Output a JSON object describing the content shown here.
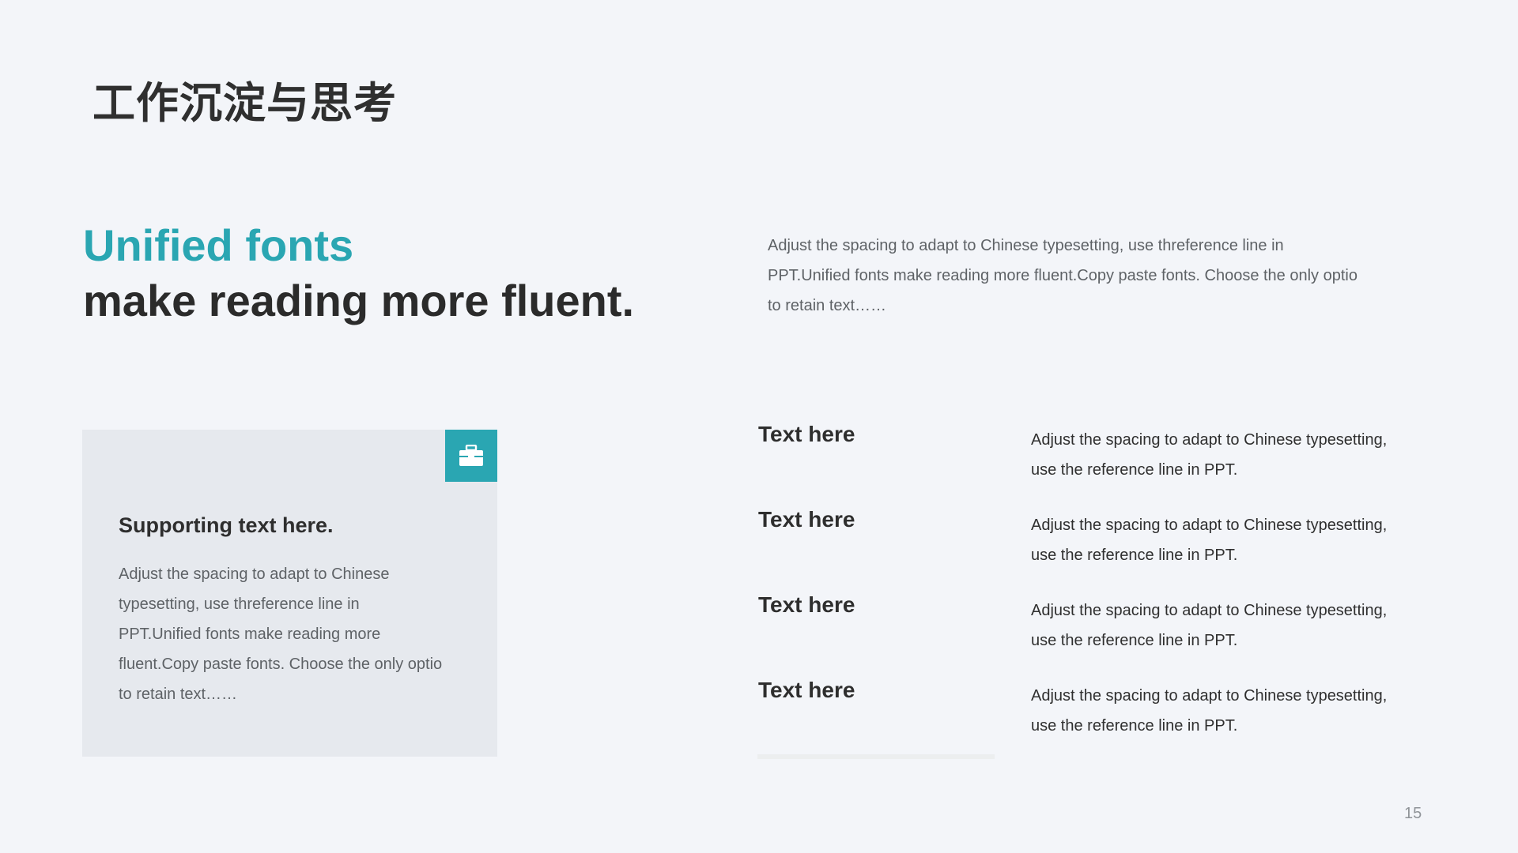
{
  "page": {
    "title": "工作沉淀与思考",
    "number": "15"
  },
  "headline": {
    "accent": "Unified fonts",
    "main": "make reading more fluent."
  },
  "intro": {
    "text": "Adjust the spacing to adapt to Chinese typesetting, use threference line in PPT.Unified fonts make reading more fluent.Copy paste fonts. Choose the only optio to retain text……"
  },
  "card": {
    "icon": "toolbox-icon",
    "heading": "Supporting text here.",
    "body": "Adjust the spacing to adapt to Chinese typesetting, use threference line in PPT.Unified fonts make reading more fluent.Copy paste fonts. Choose the only optio to retain text……"
  },
  "items": [
    {
      "title": "Text here",
      "desc": "Adjust the spacing to adapt to Chinese typesetting, use the reference line in PPT."
    },
    {
      "title": "Text here",
      "desc": "Adjust the spacing to adapt to Chinese typesetting, use the reference line in PPT."
    },
    {
      "title": "Text here",
      "desc": "Adjust the spacing to adapt to Chinese typesetting, use the reference line in PPT."
    },
    {
      "title": "Text here",
      "desc": "Adjust the spacing to adapt to Chinese typesetting, use the reference line in PPT."
    }
  ],
  "colors": {
    "accent": "#2aa6b2",
    "background": "#f3f5f9",
    "card": "#e6e9ee",
    "heading": "#2e2e2e",
    "body_text": "#5e6266"
  }
}
